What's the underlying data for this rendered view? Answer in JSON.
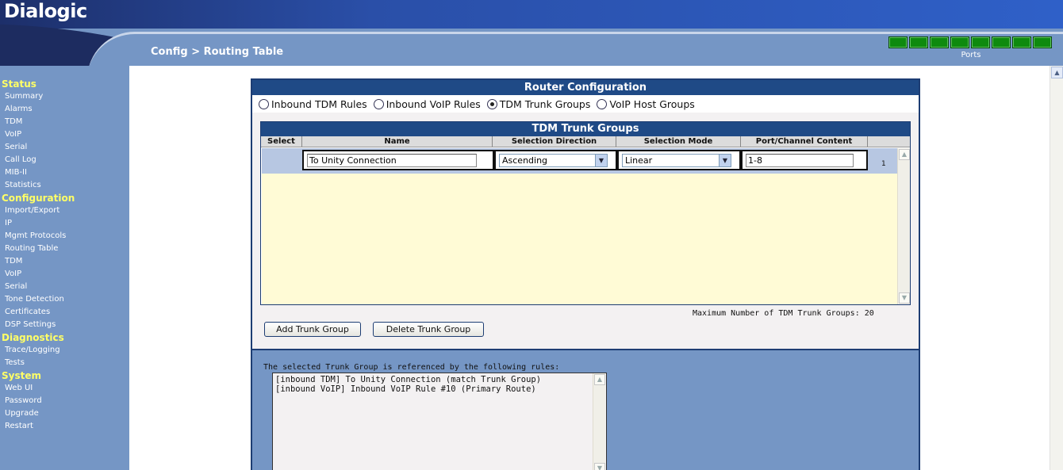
{
  "header": {
    "logo": "Dialogic",
    "breadcrumb": "Config > Routing Table",
    "ports_label": "Ports",
    "port_leds": 8,
    "led_color": "#0e8a0e"
  },
  "sidebar": {
    "sections": [
      {
        "title": "Status",
        "items": [
          "Summary",
          "Alarms",
          "TDM",
          "VoIP",
          "Serial",
          "Call Log",
          "MIB-II",
          "Statistics"
        ]
      },
      {
        "title": "Configuration",
        "items": [
          "Import/Export",
          "IP",
          "Mgmt Protocols",
          "Routing Table",
          "TDM",
          "VoIP",
          "Serial",
          "Tone Detection",
          "Certificates",
          "DSP Settings"
        ]
      },
      {
        "title": "Diagnostics",
        "items": [
          "Trace/Logging",
          "Tests"
        ]
      },
      {
        "title": "System",
        "items": [
          "Web UI",
          "Password",
          "Upgrade",
          "Restart"
        ]
      }
    ]
  },
  "router": {
    "title": "Router Configuration",
    "radios": [
      {
        "label": "Inbound TDM Rules",
        "checked": false
      },
      {
        "label": "Inbound VoIP Rules",
        "checked": false
      },
      {
        "label": "TDM Trunk Groups",
        "checked": true
      },
      {
        "label": "VoIP Host Groups",
        "checked": false
      }
    ],
    "table": {
      "title": "TDM Trunk Groups",
      "columns": [
        "Select",
        "Name",
        "Selection Direction",
        "Selection Mode",
        "Port/Channel Content"
      ],
      "rows": [
        {
          "name": "To Unity Connection",
          "direction": "Ascending",
          "mode": "Linear",
          "content": "1-8",
          "index": "1"
        }
      ]
    },
    "max_info": "Maximum Number of TDM Trunk Groups: 20",
    "buttons": {
      "add": "Add Trunk Group",
      "delete": "Delete Trunk Group"
    },
    "references": {
      "label": "The selected Trunk Group is referenced by the following rules:",
      "lines": [
        "[inbound TDM] To Unity Connection (match Trunk Group)",
        "[inbound VoIP] Inbound VoIP Rule #10 (Primary Route)"
      ]
    }
  },
  "colors": {
    "header_dark": "#1d2f6a",
    "header_blue": "#2f60c8",
    "panel_blue": "#7596c5",
    "title_bar": "#1f4a86",
    "nav_heading": "#ffff66",
    "table_body": "#fffbd6",
    "row_highlight": "#b7c7e2"
  }
}
